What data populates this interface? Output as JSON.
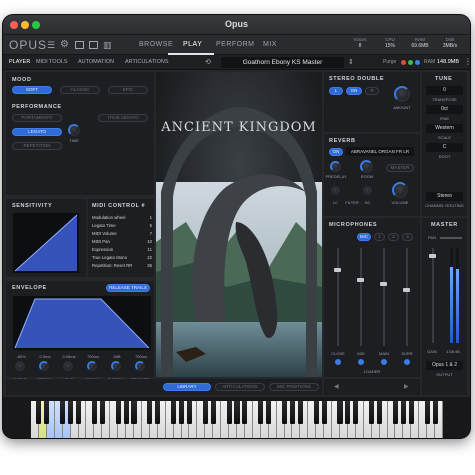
{
  "window": {
    "title": "Opus"
  },
  "menubar": {
    "logo": "OPUS",
    "tabs": [
      "BROWSE",
      "PLAY",
      "PERFORM",
      "MIX"
    ],
    "active": "PLAY",
    "stats": [
      {
        "label": "Voices",
        "value": "8"
      },
      {
        "label": "CPU",
        "value": "15%"
      },
      {
        "label": "RAM",
        "value": "69.6MB"
      },
      {
        "label": "Disk",
        "value": "3MB/s"
      }
    ]
  },
  "subbar": {
    "tabs": [
      "PLAYER",
      "MIDI TOOLS",
      "AUTOMATION",
      "ARTICULATIONS"
    ],
    "active": "PLAYER",
    "preset": "Goathorn Ebony KS Master",
    "purge": "Purge",
    "ram_label": "RAM",
    "ram_value": "148.9MB"
  },
  "mood": {
    "title": "MOOD",
    "options": [
      "SOFT",
      "CLASSIC",
      "EPIC"
    ],
    "selected": "SOFT"
  },
  "performance": {
    "title": "PERFORMANCE",
    "buttons": [
      "PORTAMENTO",
      "TRUE LEGATO",
      "LEGATO",
      "REPETITION"
    ],
    "active": "LEGATO",
    "knob": "TIME"
  },
  "sensitivity": {
    "title": "SENSITIVITY"
  },
  "midi_control": {
    "title": "MIDI CONTROL #",
    "rows": [
      {
        "name": "Modulation wheel",
        "cc": "1"
      },
      {
        "name": "Legato Time",
        "cc": "5"
      },
      {
        "name": "MIDI Volume",
        "cc": "7"
      },
      {
        "name": "MIDI Pan",
        "cc": "10"
      },
      {
        "name": "Expression",
        "cc": "11"
      },
      {
        "name": "True Legato Mono",
        "cc": "22"
      },
      {
        "name": "Repetition: Reset RR",
        "cc": "36"
      }
    ]
  },
  "envelope": {
    "title": "ENVELOPE",
    "release_button": "RELEASE TRAILS",
    "values": [
      "-80%",
      "0.0ms",
      "0.05ms",
      "700ms",
      "0dB",
      "700ms"
    ],
    "knobs": [
      "CURVE",
      "ATTACK",
      "HOLD",
      "DECAY",
      "SUSTAIN",
      "RELEASE"
    ]
  },
  "artwork": {
    "title": "ANCIENT KINGDOM"
  },
  "bottom_tabs": {
    "tabs": [
      "LIBRARY",
      "ARTICULATIONS",
      "MIC POSITIONS"
    ],
    "active": "LIBRARY"
  },
  "stereo_double": {
    "title": "STEREO DOUBLE",
    "buttons": [
      "L",
      "ON",
      "R"
    ],
    "active": "ON",
    "knob": "AMOUNT"
  },
  "reverb": {
    "title": "REVERB",
    "on": "ON",
    "preset": "ABRAVANEL ORGAN FR LR",
    "master": "MASTER",
    "knobs": [
      "PREDELAY",
      "ROOM",
      "LC",
      "FILTER",
      "HC",
      "VOLUME"
    ]
  },
  "microphones": {
    "title": "MICROPHONES",
    "buttons": [
      "MIC",
      "1",
      "2",
      "3"
    ],
    "channels": [
      "CLOSE",
      "MID",
      "MAIN",
      "SURR"
    ],
    "loader": "LOADER"
  },
  "tune": {
    "title": "TUNE",
    "transpose_value": "0",
    "transpose_label": "TRANSPOSE",
    "fine_value": "0ct",
    "fine_label": "FINE",
    "scale_value": "Western",
    "scale_label": "SCALE",
    "root_value": "C",
    "root_label": "ROOT"
  },
  "channel_routing": {
    "mode": "Stereo",
    "label": "CHANNEL ROUTING"
  },
  "master": {
    "title": "MASTER",
    "pan": "PAN",
    "gain": "GAIN",
    "gain_value": "1.58 dB",
    "output_value": "Opus 1 & 2",
    "output_label": "OUTPUT"
  }
}
